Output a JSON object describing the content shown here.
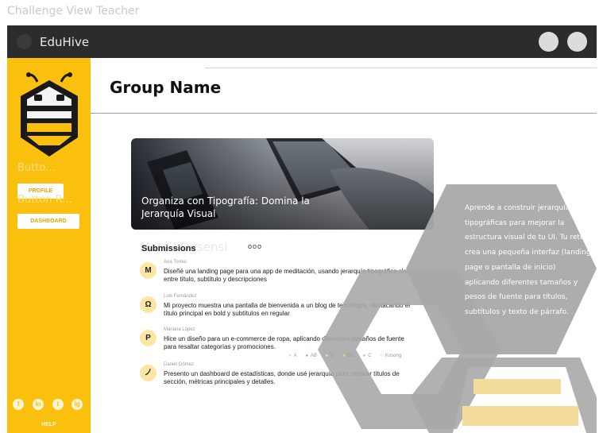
{
  "frame": {
    "title": "Challenge View Teacher"
  },
  "topbar": {
    "app_name": "EduHive"
  },
  "sidebar": {
    "ghost_label_1": "Butto...",
    "ghost_label_2": "Button R...",
    "profile_label": "PROFILE",
    "dashboard_label": "DASHBOARD",
    "social": [
      "f",
      "in",
      "t",
      "ig"
    ],
    "help_label": "HELP"
  },
  "main": {
    "title": "Group Name",
    "hero": {
      "title": "Organiza con Tipografía: Domina la Jerarquía Visual"
    },
    "ghost_heading": "Mató I Desensi",
    "submissions": {
      "title": "Submissions",
      "more": "ooo",
      "items": [
        {
          "author": "Ana Torres",
          "text": "Diseñé una landing page para una app de meditación, usando jerarquía tipográfica clara entre título, subtítulo y descripciones",
          "icon": "M"
        },
        {
          "author": "Luis Fernández",
          "text": "Mi proyecto muestra una pantalla de bienvenida a un blog de tecnología, destacando el título principal en bold y subtítulos en regular",
          "icon": "Ω"
        },
        {
          "author": "Mariana López",
          "text": "Hice un diseño para un e-commerce de ropa, aplicando diferentes tamaños de fuente para resaltar categorías y promociones.",
          "icon": "P"
        },
        {
          "author": "Daniel Gómez",
          "text": "Presento un dashboard de estadísticas, donde usé jerarquía para separar títulos de sección, métricas principales y detalles.",
          "icon": "ノ"
        }
      ]
    },
    "legend": [
      "A",
      "AB",
      "B",
      "BC",
      "C",
      "Kosong"
    ],
    "challenge_text": "Aprende a construir jerarquías tipográficas para mejorar la estructura visual de tu UI. Tu reto: crea una pequeña interfaz (landing page o pantalla de inicio) aplicando diferentes tamaños y pesos de fuente para títulos, subtítulos y texto de párrafo."
  },
  "colors": {
    "accent": "#fbbf0e",
    "topbar": "#2c2c2c",
    "hex": "#a9a9a9",
    "stripe": "#f4dc9c"
  }
}
